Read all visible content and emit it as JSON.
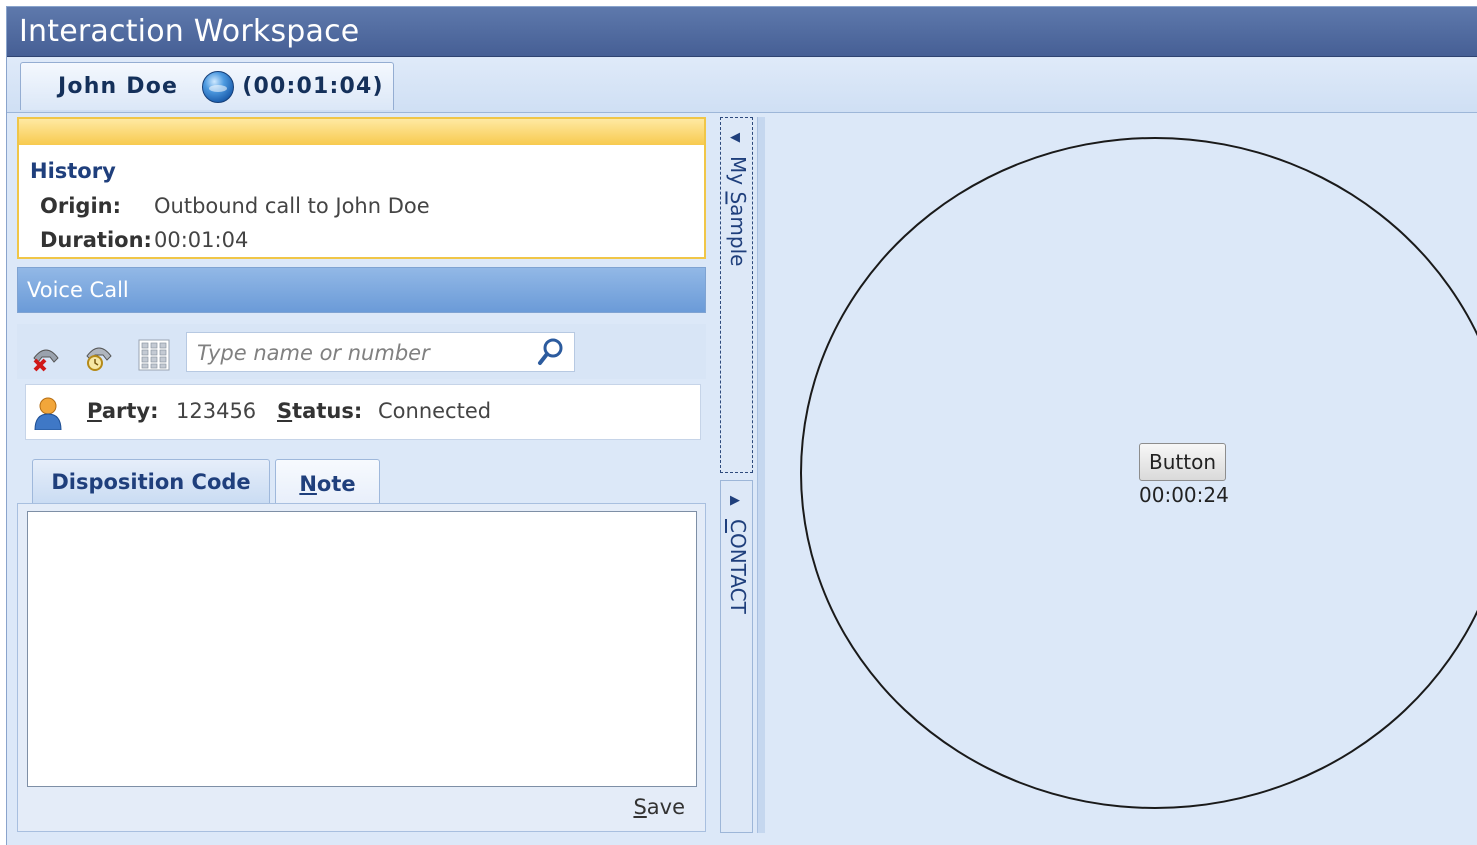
{
  "window": {
    "title": "Interaction Workspace"
  },
  "interaction_tab": {
    "name": "John Doe",
    "elapsed": "(00:01:04)"
  },
  "history": {
    "title": "History",
    "origin_label": "Origin:",
    "origin_value": "Outbound call to John Doe",
    "duration_label": "Duration:",
    "duration_value": "00:01:04"
  },
  "voice_call": {
    "title": "Voice Call",
    "search_placeholder": "Type name or number",
    "icons": [
      "hang-up-icon",
      "hold-icon",
      "dialpad-icon",
      "search-icon"
    ],
    "party_label_key": "P",
    "party_label_rest": "arty:",
    "party_value": "123456",
    "status_label_key": "S",
    "status_label_rest": "tatus:",
    "status_value": "Connected"
  },
  "subtabs": {
    "disposition": "Disposition Code",
    "note_key": "N",
    "note_rest": "ote"
  },
  "note": {
    "save_key": "S",
    "save_rest": "ave",
    "text": ""
  },
  "side_panels": {
    "my_sample_pre": "My ",
    "my_sample_key": "S",
    "my_sample_rest": "ample",
    "contact_key": "C",
    "contact_rest": "ONTACT"
  },
  "sample_view": {
    "button_label": "Button",
    "timer": "00:00:24"
  },
  "colors": {
    "titlebar": "#4f689e",
    "history_accent": "#f7ca4f",
    "voice_bar": "#7aa6dc",
    "background": "#dce8f8"
  }
}
